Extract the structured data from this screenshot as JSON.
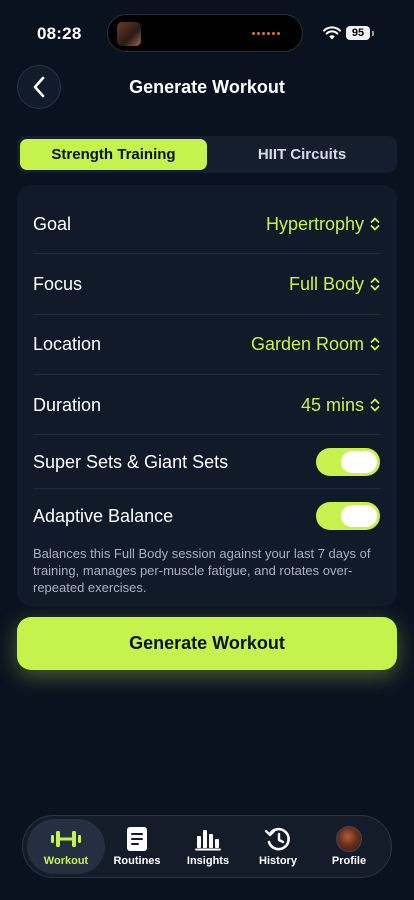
{
  "status_bar": {
    "time": "08:28",
    "battery": "95"
  },
  "header": {
    "title": "Generate Workout"
  },
  "mode_tabs": [
    {
      "label": "Strength Training",
      "selected": true
    },
    {
      "label": "HIIT Circuits",
      "selected": false
    }
  ],
  "settings": {
    "rows": [
      {
        "label": "Goal",
        "value": "Hypertrophy"
      },
      {
        "label": "Focus",
        "value": "Full Body"
      },
      {
        "label": "Location",
        "value": "Garden Room"
      },
      {
        "label": "Duration",
        "value": "45 mins"
      }
    ],
    "toggles": [
      {
        "label": "Super Sets & Giant Sets",
        "on": true
      },
      {
        "label": "Adaptive Balance",
        "on": true
      }
    ],
    "description": "Balances this Full Body session against your last 7 days of training, manages per-muscle fatigue, and rotates over-repeated exercises."
  },
  "primary_button": {
    "label": "Generate Workout"
  },
  "tab_bar": [
    {
      "label": "Workout",
      "icon": "dumbbell-icon",
      "active": true
    },
    {
      "label": "Routines",
      "icon": "document-icon",
      "active": false
    },
    {
      "label": "Insights",
      "icon": "bar-chart-icon",
      "active": false
    },
    {
      "label": "History",
      "icon": "history-icon",
      "active": false
    },
    {
      "label": "Profile",
      "icon": "avatar",
      "active": false
    }
  ],
  "colors": {
    "accent": "#c6f24e",
    "background": "#0a1220",
    "card": "#111a29"
  }
}
